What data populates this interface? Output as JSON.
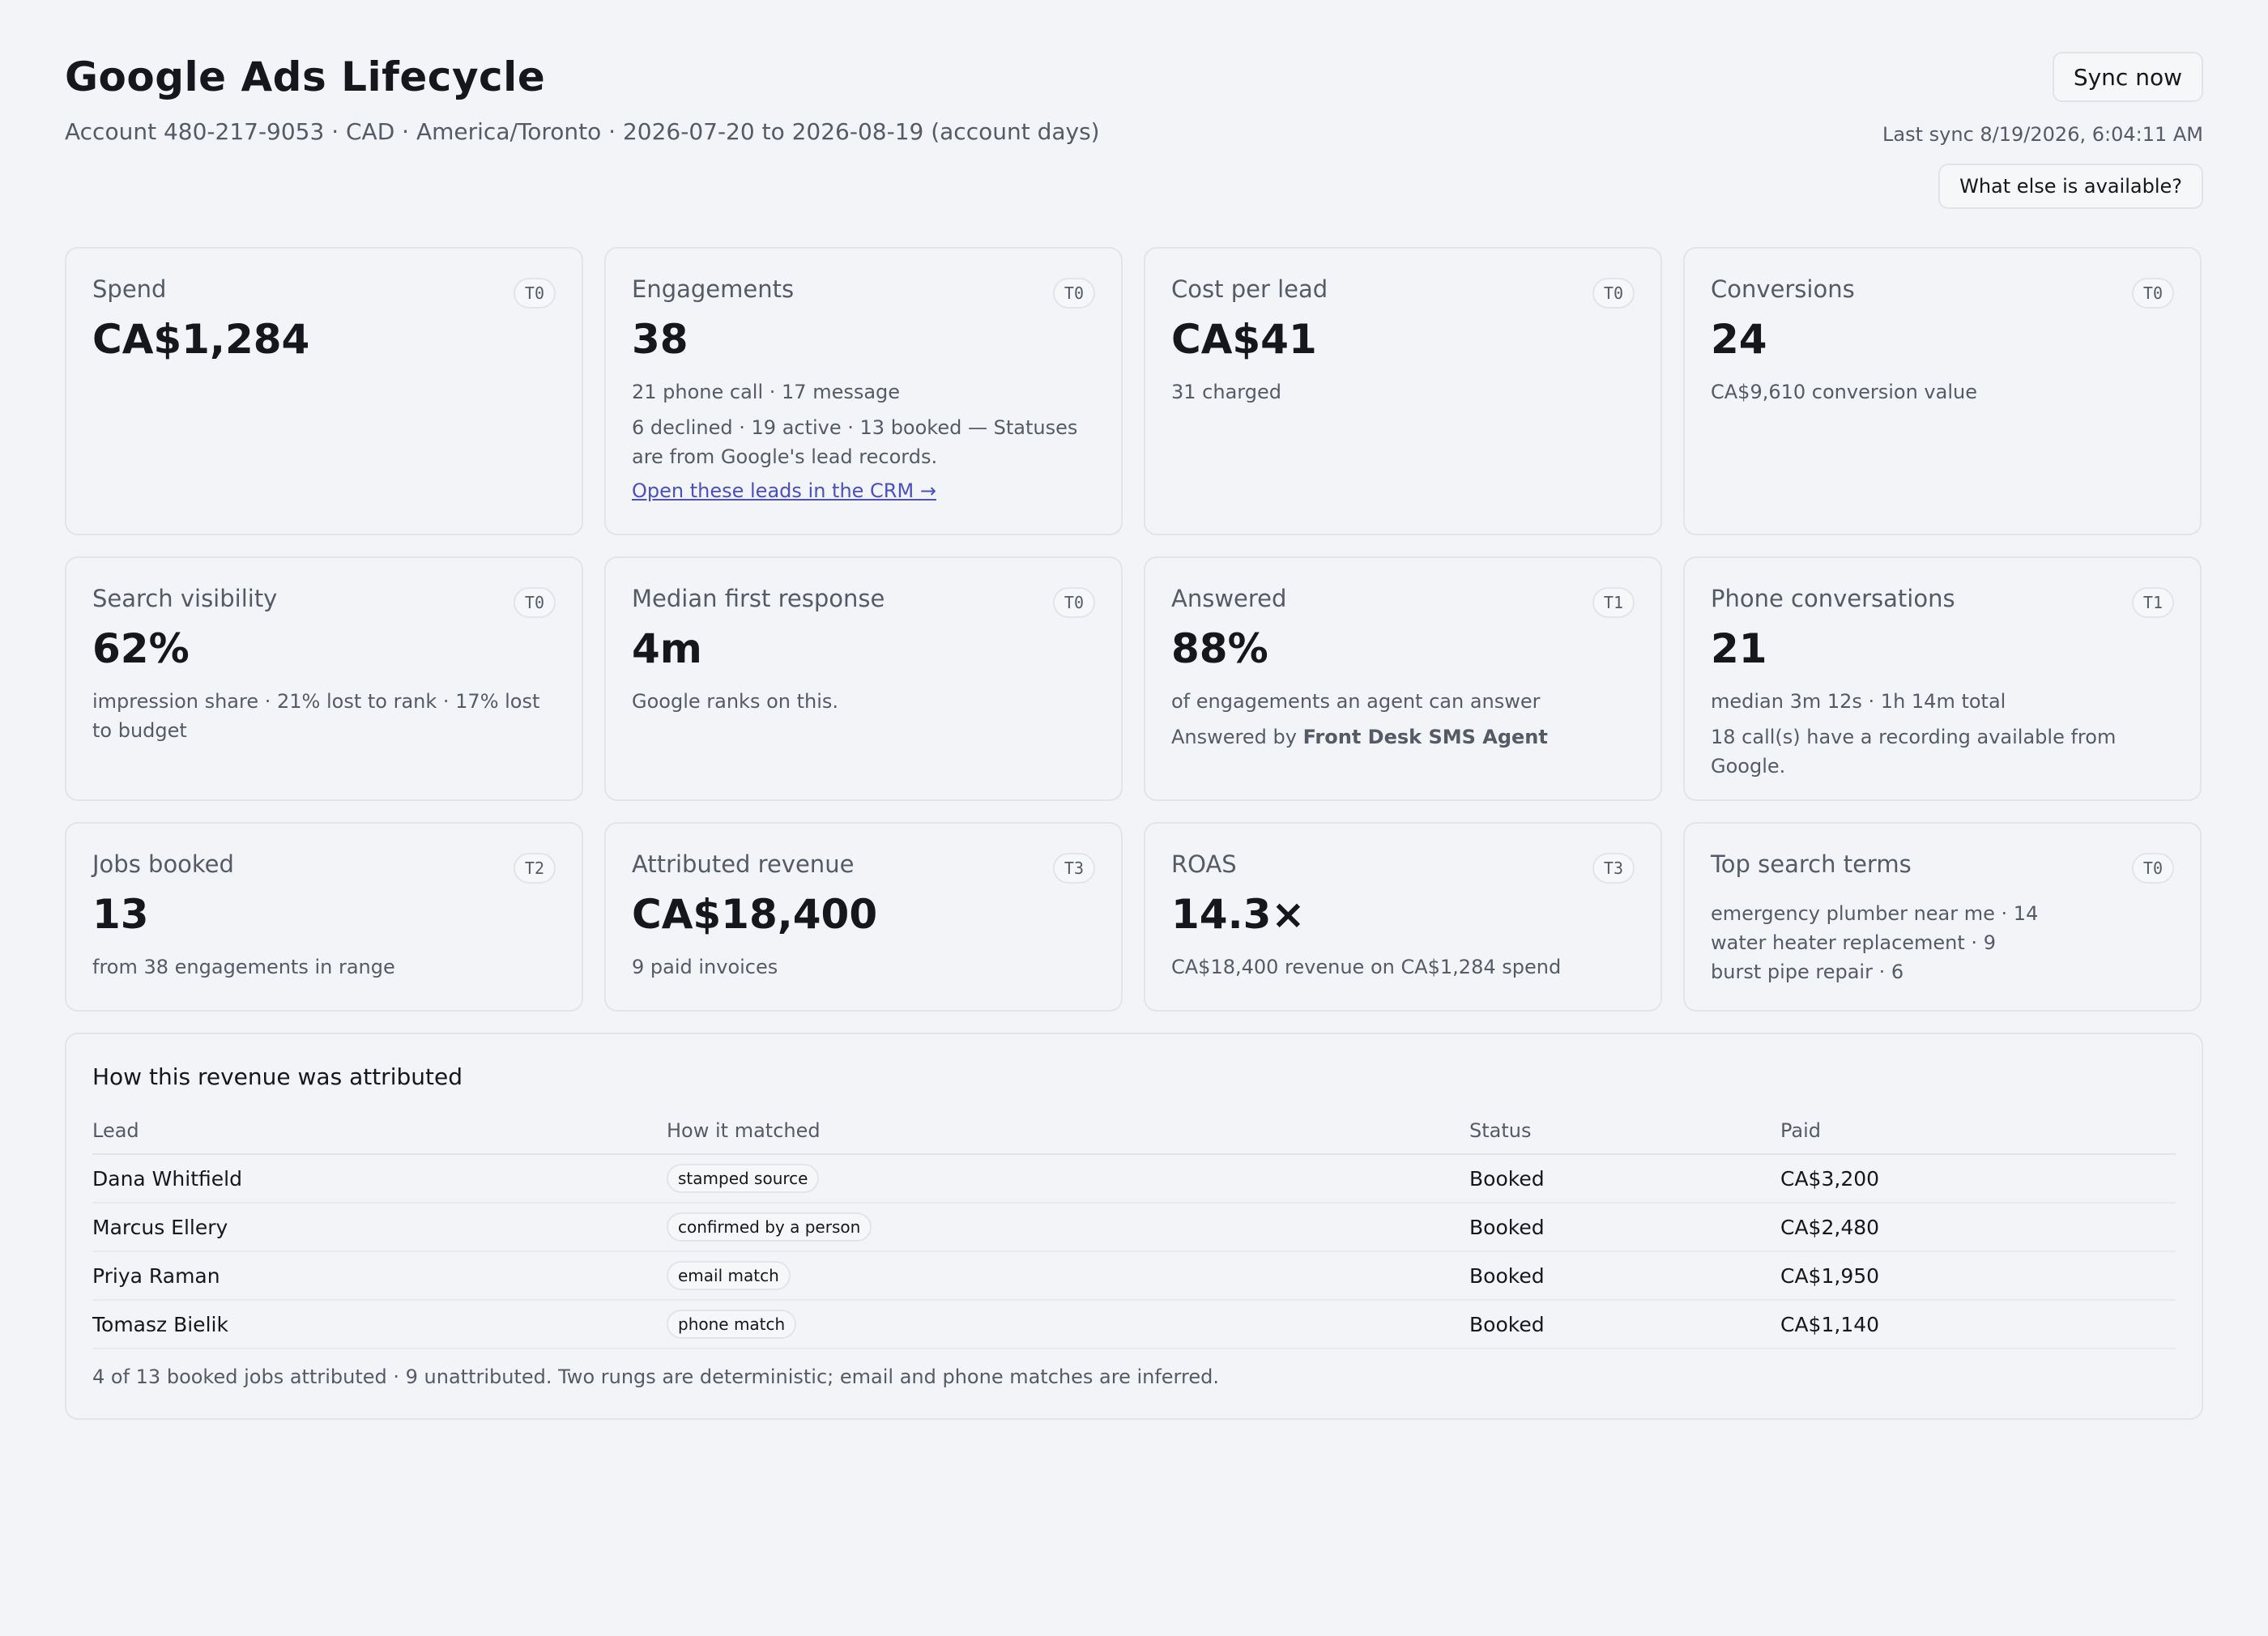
{
  "header": {
    "title": "Google Ads Lifecycle",
    "subtitle": "Account 480-217-9053 · CAD · America/Toronto · 2026-07-20 to 2026-08-19 (account days)",
    "sync_label": "Sync now",
    "last_sync": "Last sync 8/19/2026, 6:04:11 AM",
    "more_label": "What else is available?"
  },
  "cards": {
    "spend": {
      "label": "Spend",
      "tier": "T0",
      "value": "CA$1,284"
    },
    "engagements": {
      "label": "Engagements",
      "tier": "T0",
      "value": "38",
      "sub": "21 phone call · 17 message",
      "note": "6 declined · 19 active · 13 booked — Statuses are from Google's lead records.",
      "link": "Open these leads in the CRM →"
    },
    "cpl": {
      "label": "Cost per lead",
      "tier": "T0",
      "value": "CA$41",
      "sub": "31 charged"
    },
    "conversions": {
      "label": "Conversions",
      "tier": "T0",
      "value": "24",
      "sub": "CA$9,610 conversion value"
    },
    "visibility": {
      "label": "Search visibility",
      "tier": "T0",
      "value": "62%",
      "sub": "impression share · 21% lost to rank · 17% lost to budget"
    },
    "response": {
      "label": "Median first response",
      "tier": "T0",
      "value": "4m",
      "sub": "Google ranks on this."
    },
    "answered": {
      "label": "Answered",
      "tier": "T1",
      "value": "88%",
      "sub": "of engagements an agent can answer",
      "note_prefix": "Answered by ",
      "note_agent": "Front Desk SMS Agent"
    },
    "phone": {
      "label": "Phone conversations",
      "tier": "T1",
      "value": "21",
      "sub": "median 3m 12s · 1h 14m total",
      "note": "18 call(s) have a recording available from Google."
    },
    "jobs": {
      "label": "Jobs booked",
      "tier": "T2",
      "value": "13",
      "sub": "from 38 engagements in range"
    },
    "revenue": {
      "label": "Attributed revenue",
      "tier": "T3",
      "value": "CA$18,400",
      "sub": "9 paid invoices"
    },
    "roas": {
      "label": "ROAS",
      "tier": "T3",
      "value": "14.3×",
      "sub": "CA$18,400 revenue on CA$1,284 spend"
    },
    "terms": {
      "label": "Top search terms",
      "tier": "T0",
      "items": [
        "emergency plumber near me · 14",
        "water heater replacement · 9",
        "burst pipe repair · 6"
      ]
    }
  },
  "attribution": {
    "title": "How this revenue was attributed",
    "columns": [
      "Lead",
      "How it matched",
      "Status",
      "Paid"
    ],
    "rows": [
      {
        "lead": "Dana Whitfield",
        "match": "stamped source",
        "status": "Booked",
        "paid": "CA$3,200"
      },
      {
        "lead": "Marcus Ellery",
        "match": "confirmed by a person",
        "status": "Booked",
        "paid": "CA$2,480"
      },
      {
        "lead": "Priya Raman",
        "match": "email match",
        "status": "Booked",
        "paid": "CA$1,950"
      },
      {
        "lead": "Tomasz Bielik",
        "match": "phone match",
        "status": "Booked",
        "paid": "CA$1,140"
      }
    ],
    "footnote": "4 of 13 booked jobs attributed · 9 unattributed. Two rungs are deterministic; email and phone matches are inferred."
  }
}
